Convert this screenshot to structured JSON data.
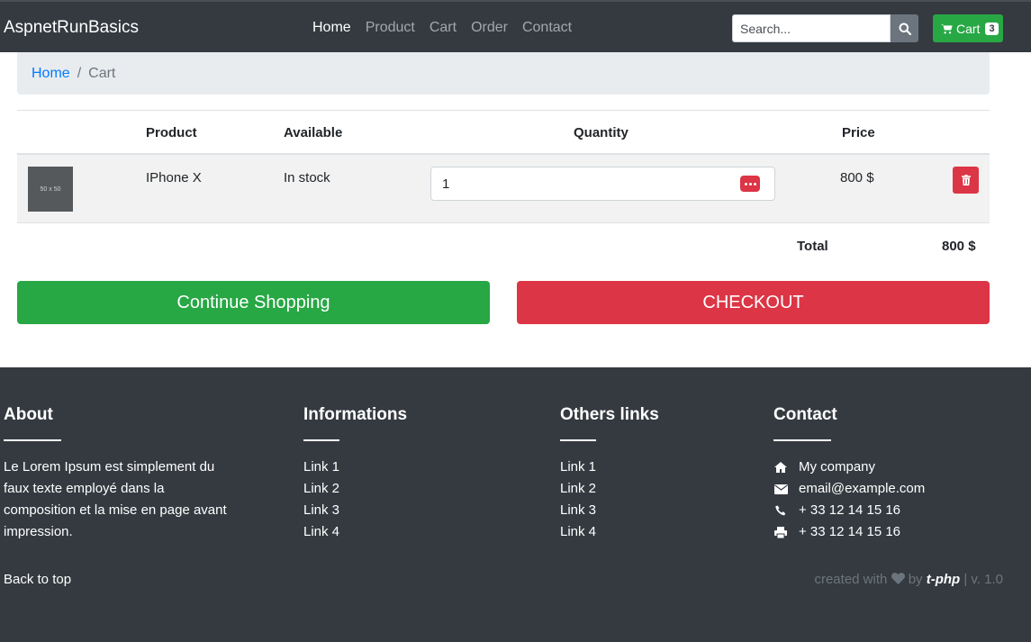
{
  "navbar": {
    "brand": "AspnetRunBasics",
    "links": [
      {
        "label": "Home"
      },
      {
        "label": "Product"
      },
      {
        "label": "Cart"
      },
      {
        "label": "Order"
      },
      {
        "label": "Contact"
      }
    ],
    "search_placeholder": "Search...",
    "cart_label": "Cart",
    "cart_count": "3"
  },
  "breadcrumb": {
    "home": "Home",
    "separator": "/",
    "current": "Cart"
  },
  "table": {
    "headers": {
      "product": "Product",
      "available": "Available",
      "quantity": "Quantity",
      "price": "Price"
    },
    "rows": [
      {
        "thumb_text": "50 x 50",
        "product": "IPhone X",
        "available": "In stock",
        "quantity": "1",
        "price": "800 $"
      }
    ],
    "total_label": "Total",
    "total_value": "800 $"
  },
  "actions": {
    "continue_label": "Continue Shopping",
    "checkout_label": "CHECKOUT"
  },
  "footer": {
    "about": {
      "title": "About",
      "text": "Le Lorem Ipsum est simplement du faux texte employé dans la composition et la mise en page avant impression."
    },
    "informations": {
      "title": "Informations",
      "links": [
        "Link 1",
        "Link 2",
        "Link 3",
        "Link 4"
      ]
    },
    "others": {
      "title": "Others links",
      "links": [
        "Link 1",
        "Link 2",
        "Link 3",
        "Link 4"
      ]
    },
    "contact": {
      "title": "Contact",
      "company": "My company",
      "email": "email@example.com",
      "phone": "+ 33 12 14 15 16",
      "fax": "+ 33 12 14 15 16"
    },
    "back_to_top": "Back to top",
    "credits_prefix": "created with",
    "credits_by": "by",
    "credits_brand": "t-php",
    "credits_version": "| v. 1.0"
  },
  "colors": {
    "navbar": "#343a40",
    "success": "#28a745",
    "danger": "#dc3545",
    "primary": "#007bff"
  }
}
